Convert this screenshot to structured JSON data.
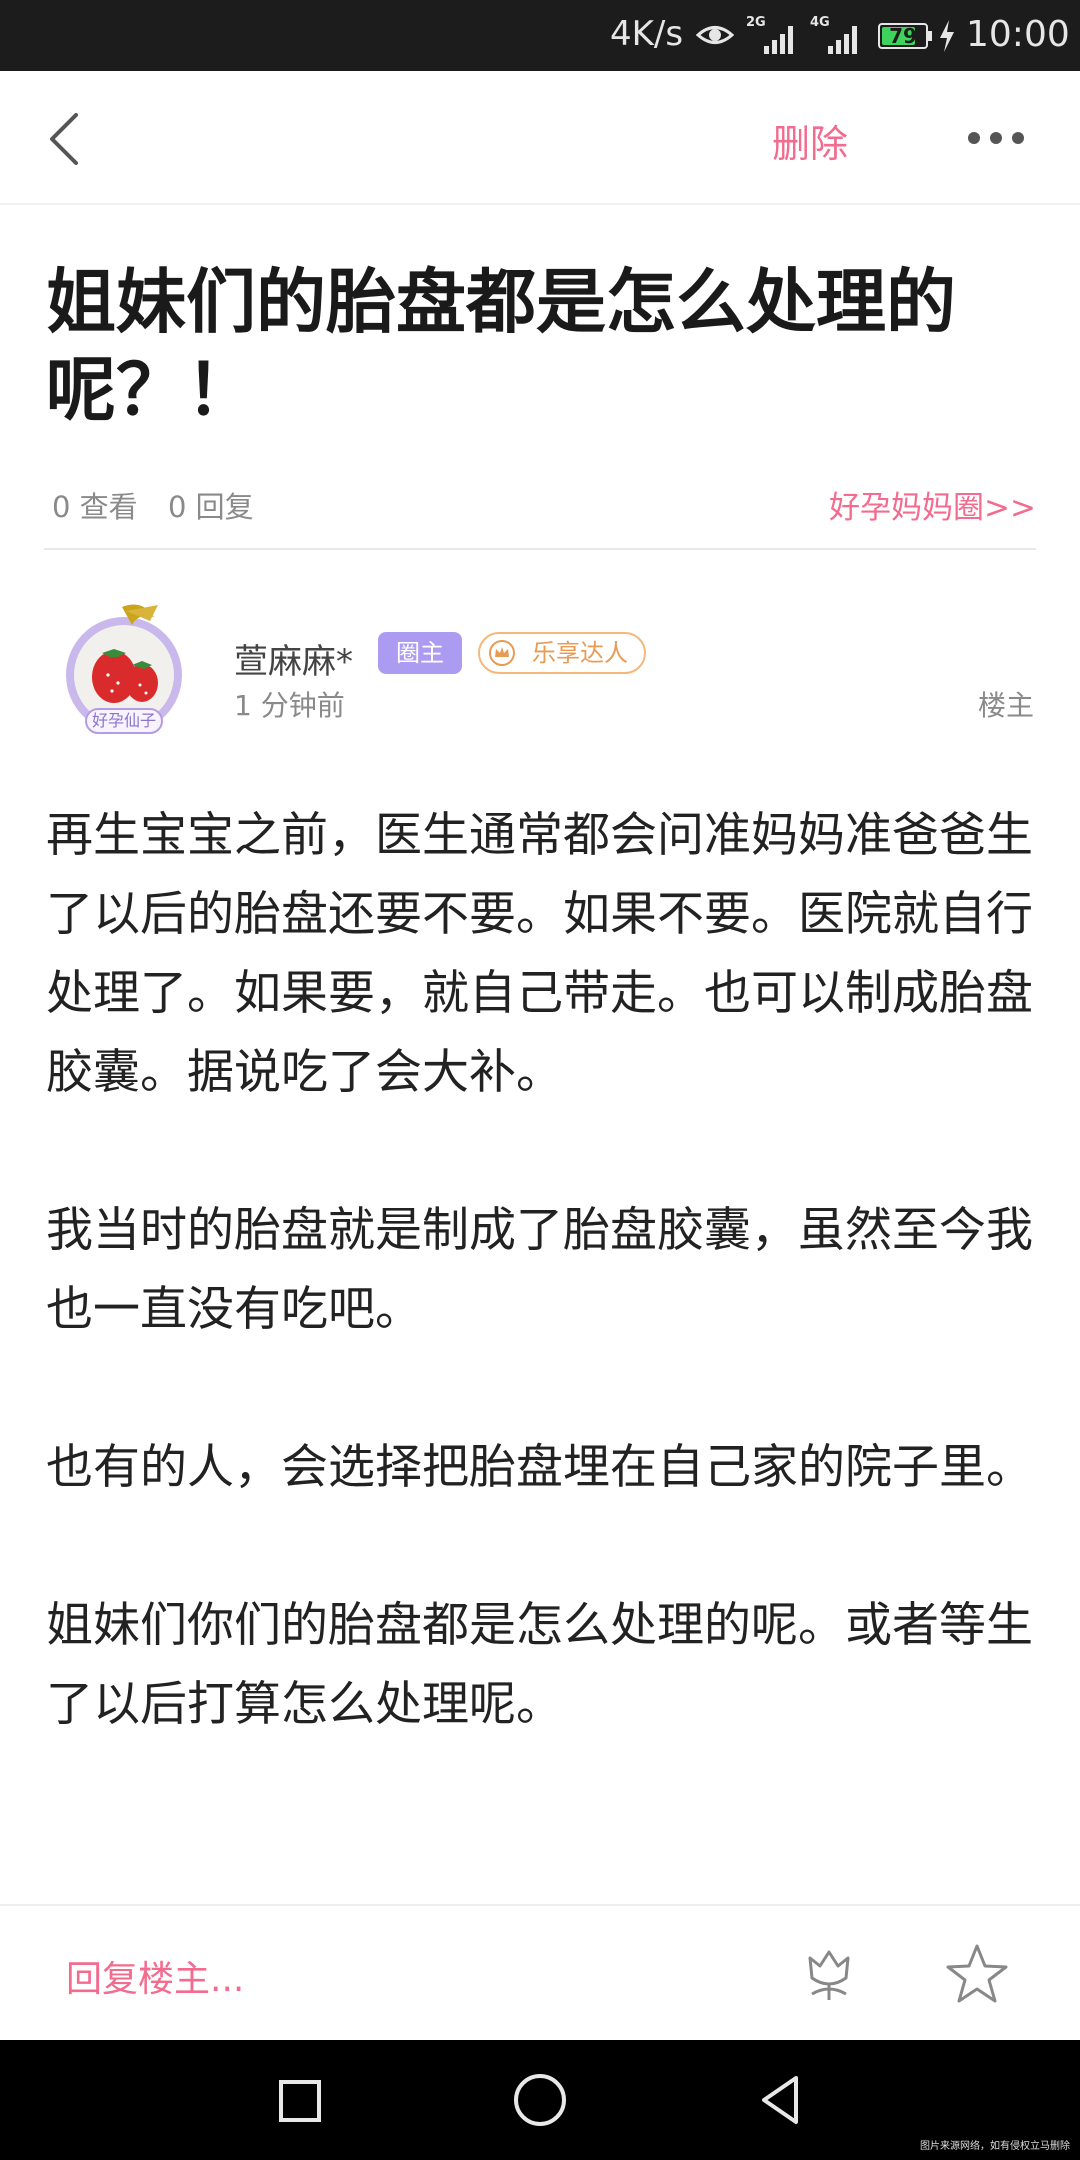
{
  "status_bar": {
    "speed": "4K/s",
    "network_1": "2G",
    "network_2": "4G",
    "battery": "79",
    "battery_level": 0.79,
    "time": "10:00"
  },
  "header": {
    "delete_label": "删除"
  },
  "post": {
    "title": "姐妹们的胎盘都是怎么处理的呢？！",
    "views": "0 查看",
    "replies": "0 回复",
    "circle_link": "好孕妈妈圈>>",
    "author": {
      "name": "萱麻麻*",
      "owner_badge": "圈主",
      "level_badge": "乐享达人",
      "avatar_caption": "好孕仙子",
      "time": "1 分钟前",
      "floor": "楼主"
    },
    "paragraphs": [
      "再生宝宝之前，医生通常都会问准妈妈准爸爸生了以后的胎盘还要不要。如果不要。医院就自行处理了。如果要，就自己带走。也可以制成胎盘胶囊。据说吃了会大补。",
      "我当时的胎盘就是制成了胎盘胶囊，虽然至今我也一直没有吃吧。",
      "也有的人，会选择把胎盘埋在自己家的院子里。",
      "姐妹们你们的胎盘都是怎么处理的呢。或者等生了以后打算怎么处理呢。"
    ]
  },
  "reply_bar": {
    "placeholder": "回复楼主...",
    "icons": [
      "flower-icon",
      "star-icon"
    ]
  },
  "nav_bar": {
    "icons": [
      "recent-apps-icon",
      "home-icon",
      "back-icon"
    ]
  },
  "watermark": "图片来源网络，如有侵权立马删除",
  "colors": {
    "accent": "#f36c8f",
    "owner_badge": "#ab9cf2",
    "level_badge": "#f5b77b"
  }
}
